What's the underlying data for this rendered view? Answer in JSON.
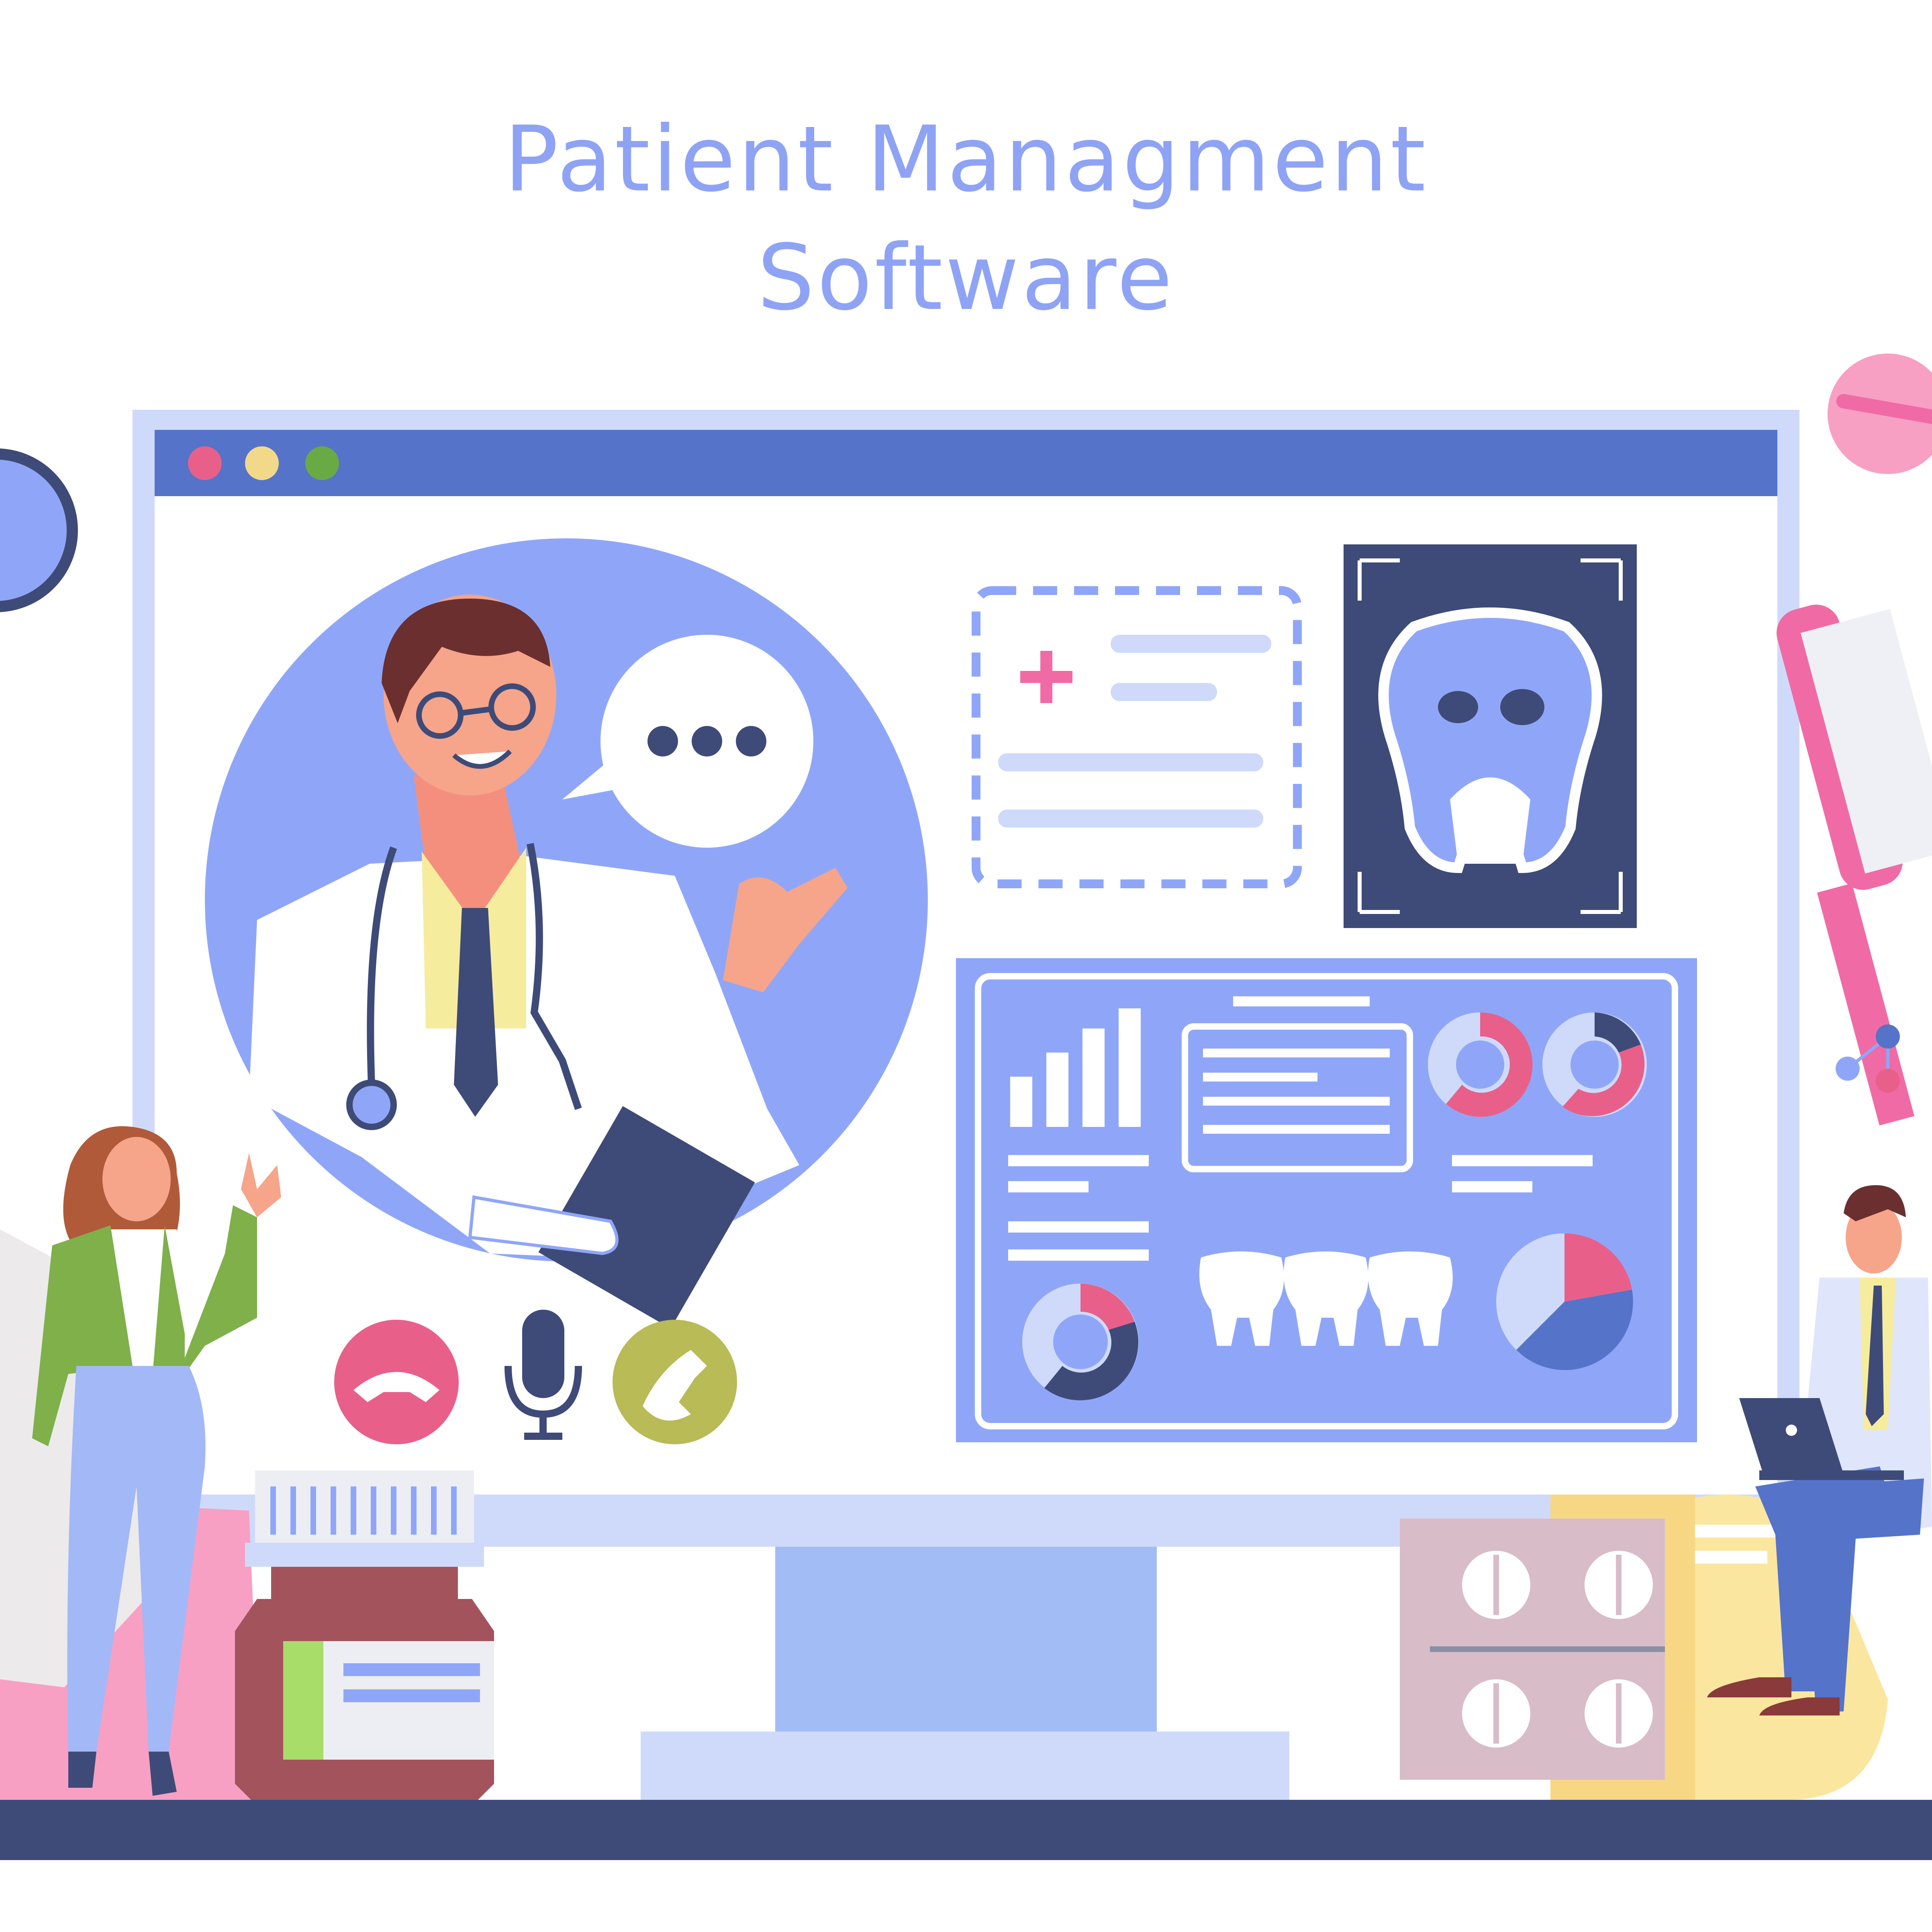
{
  "title": {
    "line1": "Patient Managment",
    "line2": "Software"
  },
  "colors": {
    "title": "#8fa3f5",
    "monitor_frame": "#cfdafa",
    "browser_bar": "#5573c9",
    "dark_navy": "#3e4b78",
    "periwinkle": "#8fa6f8",
    "pink": "#e8608a",
    "olive": "#b8bb56",
    "pink_accent": "#f06ba5"
  },
  "icons": [
    "window-dot-red",
    "window-dot-yellow",
    "window-dot-green",
    "medical-cross-icon",
    "tooth-xray-icon",
    "chat-bubble-icon",
    "end-call-icon",
    "microphone-icon",
    "accept-call-icon",
    "bar-chart-icon",
    "donut-chart-icon",
    "pie-chart-icon",
    "tooth-icon",
    "pill-icon",
    "toothbrush-icon",
    "medicine-bottle-icon",
    "pill-blister-icon"
  ]
}
